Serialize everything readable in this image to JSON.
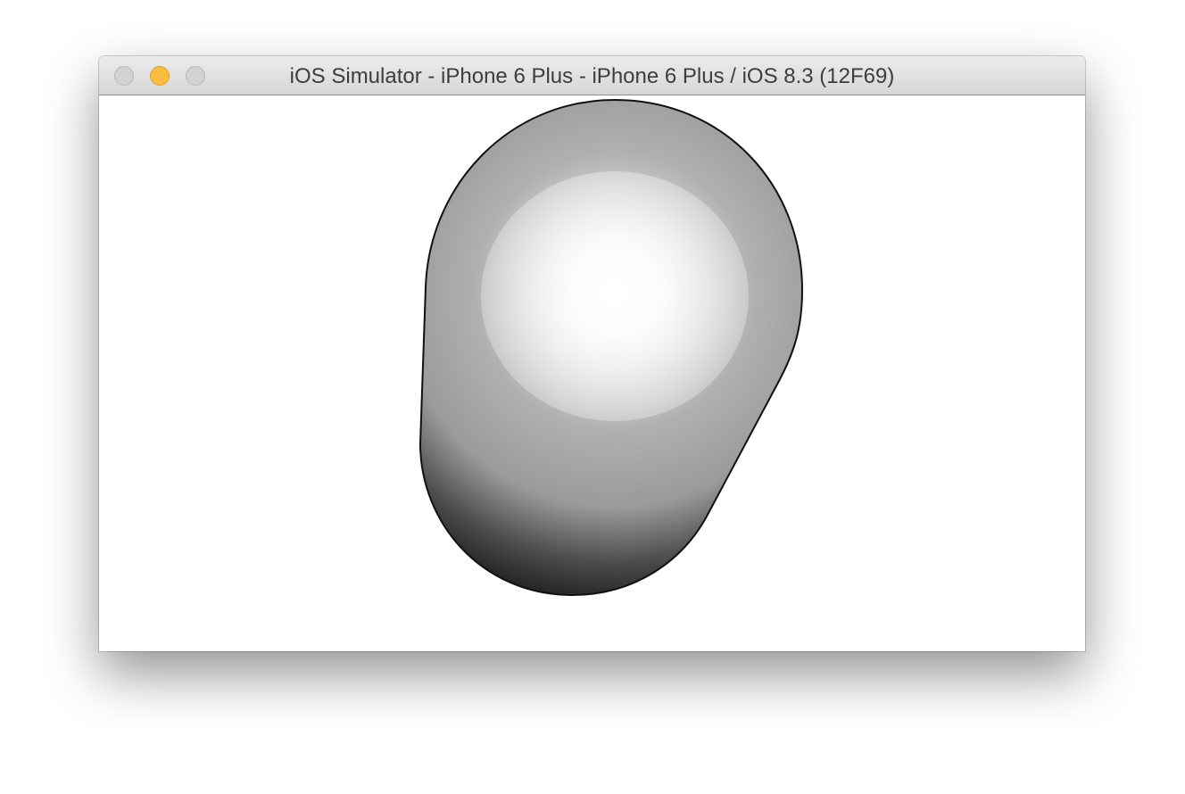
{
  "window": {
    "title": "iOS Simulator - iPhone 6 Plus - iPhone 6 Plus / iOS 8.3 (12F69)",
    "controls": {
      "close_icon": "close-icon",
      "minimize_icon": "minimize-icon",
      "zoom_icon": "zoom-icon",
      "minimize_color": "#fcbc3f",
      "inactive_color": "#d2d2d2"
    }
  },
  "canvas": {
    "background": "#ffffff",
    "shape": {
      "fill_center_color": "#ffffff",
      "fill_mid_color": "#b0b0b0",
      "edge_color": "#1a1a1a"
    }
  }
}
